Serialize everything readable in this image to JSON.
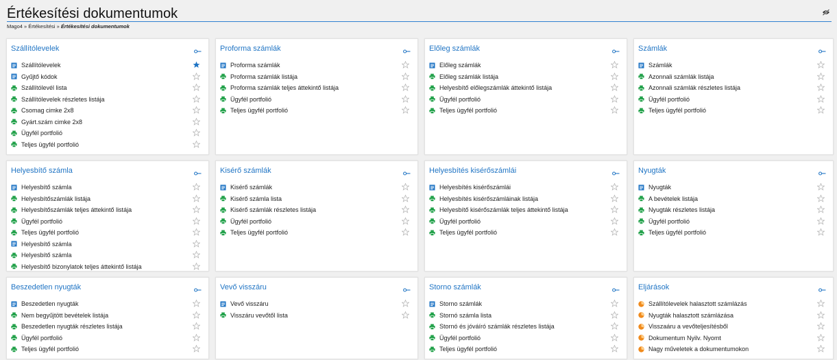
{
  "page": {
    "title": "Értékesítési dokumentumok",
    "breadcrumb": {
      "root": "Mago4",
      "sep1": "»",
      "parent": "Értékesítési",
      "sep2": "»",
      "current": "Értékesítési dokumentumok"
    }
  },
  "colors": {
    "accent": "#1f74c4",
    "doc_icon": "#1f74c4",
    "report_icon": "#22a14a",
    "proc_icon": "#f08a1c",
    "star_filled": "#1f74c4",
    "star_empty": "#b5b5b5"
  },
  "cards": [
    {
      "title": "Szállítólevelek",
      "items": [
        {
          "label": "Szállítólevelek",
          "icon": "doc",
          "fav": true
        },
        {
          "label": "Gyűjtő kódok",
          "icon": "doc",
          "fav": false
        },
        {
          "label": "Szállítólevél lista",
          "icon": "report",
          "fav": false
        },
        {
          "label": "Szállítólevelek részletes listája",
          "icon": "report",
          "fav": false
        },
        {
          "label": "Csomag cimke 2x8",
          "icon": "report",
          "fav": false
        },
        {
          "label": "Gyárt.szám cimke 2x8",
          "icon": "report",
          "fav": false
        },
        {
          "label": "Ügyfél portfolió",
          "icon": "report",
          "fav": false
        },
        {
          "label": "Teljes ügyfél portfolió",
          "icon": "report",
          "fav": false
        }
      ]
    },
    {
      "title": "Proforma számlák",
      "items": [
        {
          "label": "Proforma számlák",
          "icon": "doc",
          "fav": false
        },
        {
          "label": "Proforma számlák listája",
          "icon": "report",
          "fav": false
        },
        {
          "label": "Proforma számlák teljes áttekintő listája",
          "icon": "report",
          "fav": false
        },
        {
          "label": "Ügyfél portfolió",
          "icon": "report",
          "fav": false
        },
        {
          "label": "Teljes ügyfél portfolió",
          "icon": "report",
          "fav": false
        }
      ]
    },
    {
      "title": "Előleg számlák",
      "items": [
        {
          "label": "Előleg számlák",
          "icon": "doc",
          "fav": false
        },
        {
          "label": "Előleg számlák listája",
          "icon": "report",
          "fav": false
        },
        {
          "label": "Helyesbítő előlegszámlák áttekintő listája",
          "icon": "report",
          "fav": false
        },
        {
          "label": "Ügyfél portfolió",
          "icon": "report",
          "fav": false
        },
        {
          "label": "Teljes ügyfél portfolió",
          "icon": "report",
          "fav": false
        }
      ]
    },
    {
      "title": "Számlák",
      "items": [
        {
          "label": "Számlák",
          "icon": "doc",
          "fav": false
        },
        {
          "label": "Azonnali számlák listája",
          "icon": "report",
          "fav": false
        },
        {
          "label": "Azonnali számlák részletes listája",
          "icon": "report",
          "fav": false
        },
        {
          "label": "Ügyfél portfolió",
          "icon": "report",
          "fav": false
        },
        {
          "label": "Teljes ügyfél portfolió",
          "icon": "report",
          "fav": false
        }
      ]
    },
    {
      "title": "Helyesbítő számla",
      "items": [
        {
          "label": "Helyesbítő számla",
          "icon": "doc",
          "fav": false
        },
        {
          "label": "Helyesbítőszámlák listája",
          "icon": "report",
          "fav": false
        },
        {
          "label": "Helyesbítőszámlák teljes áttekintő listája",
          "icon": "report",
          "fav": false
        },
        {
          "label": "Ügyfél portfolió",
          "icon": "report",
          "fav": false
        },
        {
          "label": "Teljes ügyfél portfolió",
          "icon": "report",
          "fav": false
        },
        {
          "label": "Helyesbítő számla",
          "icon": "doc",
          "fav": false
        },
        {
          "label": "Helyesbítő számla",
          "icon": "report",
          "fav": false
        },
        {
          "label": "Helyesbítő bizonylatok teljes áttekintő listája",
          "icon": "report",
          "fav": false
        }
      ]
    },
    {
      "title": "Kisérő számlák",
      "items": [
        {
          "label": "Kisérő számlák",
          "icon": "doc",
          "fav": false
        },
        {
          "label": "Kisérő számla lista",
          "icon": "report",
          "fav": false
        },
        {
          "label": "Kisérő számlák részletes listája",
          "icon": "report",
          "fav": false
        },
        {
          "label": "Ügyfél portfolió",
          "icon": "report",
          "fav": false
        },
        {
          "label": "Teljes ügyfél portfolió",
          "icon": "report",
          "fav": false
        }
      ]
    },
    {
      "title": "Helyesbítés kisérőszámlái",
      "items": [
        {
          "label": "Helyesbítés kisérőszámlái",
          "icon": "doc",
          "fav": false
        },
        {
          "label": "Helyesbítés kisérőszámláinak listája",
          "icon": "report",
          "fav": false
        },
        {
          "label": "Helyesbítő kisérőszámlák teljes áttekintő listája",
          "icon": "report",
          "fav": false
        },
        {
          "label": "Ügyfél portfolió",
          "icon": "report",
          "fav": false
        },
        {
          "label": "Teljes ügyfél portfolió",
          "icon": "report",
          "fav": false
        }
      ]
    },
    {
      "title": "Nyugták",
      "items": [
        {
          "label": "Nyugták",
          "icon": "doc",
          "fav": false
        },
        {
          "label": "A bevételek listája",
          "icon": "report",
          "fav": false
        },
        {
          "label": "Nyugták részletes listája",
          "icon": "report",
          "fav": false
        },
        {
          "label": "Ügyfél portfolió",
          "icon": "report",
          "fav": false
        },
        {
          "label": "Teljes ügyfél portfolió",
          "icon": "report",
          "fav": false
        }
      ]
    },
    {
      "title": "Beszedetlen nyugták",
      "items": [
        {
          "label": "Beszedetlen nyugták",
          "icon": "doc",
          "fav": false
        },
        {
          "label": "Nem begyűjtött bevételek listája",
          "icon": "report",
          "fav": false
        },
        {
          "label": "Beszedetlen nyugták részletes listája",
          "icon": "report",
          "fav": false
        },
        {
          "label": "Ügyfél portfolió",
          "icon": "report",
          "fav": false
        },
        {
          "label": "Teljes ügyfél portfolió",
          "icon": "report",
          "fav": false
        }
      ]
    },
    {
      "title": "Vevő visszáru",
      "items": [
        {
          "label": "Vevő visszáru",
          "icon": "doc",
          "fav": false
        },
        {
          "label": "Visszáru vevőtől lista",
          "icon": "report",
          "fav": false
        }
      ]
    },
    {
      "title": "Storno számlák",
      "items": [
        {
          "label": "Storno számlák",
          "icon": "doc",
          "fav": false
        },
        {
          "label": "Stornó számla lista",
          "icon": "report",
          "fav": false
        },
        {
          "label": "Stornó és jóváíró számlák részletes listája",
          "icon": "report",
          "fav": false
        },
        {
          "label": "Ügyfél portfolió",
          "icon": "report",
          "fav": false
        },
        {
          "label": "Teljes ügyfél portfolió",
          "icon": "report",
          "fav": false
        }
      ]
    },
    {
      "title": "Eljárások",
      "items": [
        {
          "label": "Szállítólevelek halasztott számlázás",
          "icon": "proc",
          "fav": false
        },
        {
          "label": "Nyugták halasztott számlázása",
          "icon": "proc",
          "fav": false
        },
        {
          "label": "Visszaáru a vevőteljesítésből",
          "icon": "proc",
          "fav": false
        },
        {
          "label": "Dokumentum Nyilv. Nyomt",
          "icon": "proc",
          "fav": false
        },
        {
          "label": "Nagy műveletek a dokumentumokon",
          "icon": "proc",
          "fav": false
        }
      ]
    }
  ]
}
